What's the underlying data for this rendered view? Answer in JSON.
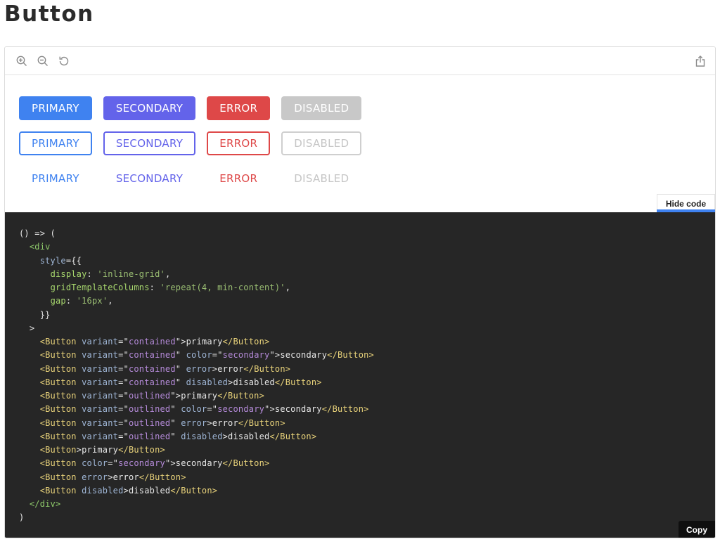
{
  "page": {
    "title": "Button"
  },
  "toolbar": {
    "icons": [
      "zoom-in-icon",
      "zoom-out-icon",
      "reset-zoom-icon",
      "share-icon"
    ]
  },
  "preview": {
    "rows": [
      {
        "variant": "contained",
        "buttons": [
          {
            "label": "PRIMARY",
            "color": "primary",
            "disabled": false
          },
          {
            "label": "SECONDARY",
            "color": "secondary",
            "disabled": false
          },
          {
            "label": "ERROR",
            "color": "error",
            "disabled": false
          },
          {
            "label": "DISABLED",
            "color": "disabled",
            "disabled": true
          }
        ]
      },
      {
        "variant": "outlined",
        "buttons": [
          {
            "label": "PRIMARY",
            "color": "primary",
            "disabled": false
          },
          {
            "label": "SECONDARY",
            "color": "secondary",
            "disabled": false
          },
          {
            "label": "ERROR",
            "color": "error",
            "disabled": false
          },
          {
            "label": "DISABLED",
            "color": "disabled",
            "disabled": true
          }
        ]
      },
      {
        "variant": "text",
        "buttons": [
          {
            "label": "PRIMARY",
            "color": "primary",
            "disabled": false
          },
          {
            "label": "SECONDARY",
            "color": "secondary",
            "disabled": false
          },
          {
            "label": "ERROR",
            "color": "error",
            "disabled": false
          },
          {
            "label": "DISABLED",
            "color": "disabled",
            "disabled": true
          }
        ]
      }
    ]
  },
  "colors": {
    "primary": "#3f82f0",
    "secondary": "#6363ea",
    "error": "#de4848",
    "disabled": "#c8c8c8",
    "code_background": "#262626",
    "tag": "#e8d27a",
    "attribute": "#9fb6d6",
    "string": "#b48ad8",
    "css_property": "#a8d86e",
    "css_string": "#9bbf73",
    "jsx_tag": "#8ec96a"
  },
  "code": {
    "hide_label": "Hide code",
    "copy_label": "Copy",
    "lines": [
      [
        {
          "t": "() => (",
          "c": "p"
        }
      ],
      [
        {
          "t": "  ",
          "c": "p"
        },
        {
          "t": "<div",
          "c": "jt"
        }
      ],
      [
        {
          "t": "    ",
          "c": "p"
        },
        {
          "t": "style",
          "c": "at"
        },
        {
          "t": "={{",
          "c": "p"
        }
      ],
      [
        {
          "t": "      ",
          "c": "p"
        },
        {
          "t": "display",
          "c": "cp"
        },
        {
          "t": ": ",
          "c": "p"
        },
        {
          "t": "'inline-grid'",
          "c": "cs"
        },
        {
          "t": ",",
          "c": "p"
        }
      ],
      [
        {
          "t": "      ",
          "c": "p"
        },
        {
          "t": "gridTemplateColumns",
          "c": "cp"
        },
        {
          "t": ": ",
          "c": "p"
        },
        {
          "t": "'repeat(4, min-content)'",
          "c": "cs"
        },
        {
          "t": ",",
          "c": "p"
        }
      ],
      [
        {
          "t": "      ",
          "c": "p"
        },
        {
          "t": "gap",
          "c": "cp"
        },
        {
          "t": ": ",
          "c": "p"
        },
        {
          "t": "'16px'",
          "c": "cs"
        },
        {
          "t": ",",
          "c": "p"
        }
      ],
      [
        {
          "t": "    }}",
          "c": "p"
        }
      ],
      [
        {
          "t": "  >",
          "c": "p"
        }
      ],
      [
        {
          "t": "    ",
          "c": "p"
        },
        {
          "t": "<Button",
          "c": "tg"
        },
        {
          "t": " variant",
          "c": "at"
        },
        {
          "t": "=\"",
          "c": "p"
        },
        {
          "t": "contained",
          "c": "st"
        },
        {
          "t": "\">primary",
          "c": "p"
        },
        {
          "t": "</Button>",
          "c": "tg"
        }
      ],
      [
        {
          "t": "    ",
          "c": "p"
        },
        {
          "t": "<Button",
          "c": "tg"
        },
        {
          "t": " variant",
          "c": "at"
        },
        {
          "t": "=\"",
          "c": "p"
        },
        {
          "t": "contained",
          "c": "st"
        },
        {
          "t": "\"",
          "c": "p"
        },
        {
          "t": " color",
          "c": "at"
        },
        {
          "t": "=\"",
          "c": "p"
        },
        {
          "t": "secondary",
          "c": "st"
        },
        {
          "t": "\">secondary",
          "c": "p"
        },
        {
          "t": "</Button>",
          "c": "tg"
        }
      ],
      [
        {
          "t": "    ",
          "c": "p"
        },
        {
          "t": "<Button",
          "c": "tg"
        },
        {
          "t": " variant",
          "c": "at"
        },
        {
          "t": "=\"",
          "c": "p"
        },
        {
          "t": "contained",
          "c": "st"
        },
        {
          "t": "\"",
          "c": "p"
        },
        {
          "t": " error",
          "c": "at"
        },
        {
          "t": ">error",
          "c": "p"
        },
        {
          "t": "</Button>",
          "c": "tg"
        }
      ],
      [
        {
          "t": "    ",
          "c": "p"
        },
        {
          "t": "<Button",
          "c": "tg"
        },
        {
          "t": " variant",
          "c": "at"
        },
        {
          "t": "=\"",
          "c": "p"
        },
        {
          "t": "contained",
          "c": "st"
        },
        {
          "t": "\"",
          "c": "p"
        },
        {
          "t": " disabled",
          "c": "at"
        },
        {
          "t": ">disabled",
          "c": "p"
        },
        {
          "t": "</Button>",
          "c": "tg"
        }
      ],
      [
        {
          "t": "    ",
          "c": "p"
        },
        {
          "t": "<Button",
          "c": "tg"
        },
        {
          "t": " variant",
          "c": "at"
        },
        {
          "t": "=\"",
          "c": "p"
        },
        {
          "t": "outlined",
          "c": "st"
        },
        {
          "t": "\">primary",
          "c": "p"
        },
        {
          "t": "</Button>",
          "c": "tg"
        }
      ],
      [
        {
          "t": "    ",
          "c": "p"
        },
        {
          "t": "<Button",
          "c": "tg"
        },
        {
          "t": " variant",
          "c": "at"
        },
        {
          "t": "=\"",
          "c": "p"
        },
        {
          "t": "outlined",
          "c": "st"
        },
        {
          "t": "\"",
          "c": "p"
        },
        {
          "t": " color",
          "c": "at"
        },
        {
          "t": "=\"",
          "c": "p"
        },
        {
          "t": "secondary",
          "c": "st"
        },
        {
          "t": "\">secondary",
          "c": "p"
        },
        {
          "t": "</Button>",
          "c": "tg"
        }
      ],
      [
        {
          "t": "    ",
          "c": "p"
        },
        {
          "t": "<Button",
          "c": "tg"
        },
        {
          "t": " variant",
          "c": "at"
        },
        {
          "t": "=\"",
          "c": "p"
        },
        {
          "t": "outlined",
          "c": "st"
        },
        {
          "t": "\"",
          "c": "p"
        },
        {
          "t": " error",
          "c": "at"
        },
        {
          "t": ">error",
          "c": "p"
        },
        {
          "t": "</Button>",
          "c": "tg"
        }
      ],
      [
        {
          "t": "    ",
          "c": "p"
        },
        {
          "t": "<Button",
          "c": "tg"
        },
        {
          "t": " variant",
          "c": "at"
        },
        {
          "t": "=\"",
          "c": "p"
        },
        {
          "t": "outlined",
          "c": "st"
        },
        {
          "t": "\"",
          "c": "p"
        },
        {
          "t": " disabled",
          "c": "at"
        },
        {
          "t": ">disabled",
          "c": "p"
        },
        {
          "t": "</Button>",
          "c": "tg"
        }
      ],
      [
        {
          "t": "    ",
          "c": "p"
        },
        {
          "t": "<Button",
          "c": "tg"
        },
        {
          "t": ">primary",
          "c": "p"
        },
        {
          "t": "</Button>",
          "c": "tg"
        }
      ],
      [
        {
          "t": "    ",
          "c": "p"
        },
        {
          "t": "<Button",
          "c": "tg"
        },
        {
          "t": " color",
          "c": "at"
        },
        {
          "t": "=\"",
          "c": "p"
        },
        {
          "t": "secondary",
          "c": "st"
        },
        {
          "t": "\">secondary",
          "c": "p"
        },
        {
          "t": "</Button>",
          "c": "tg"
        }
      ],
      [
        {
          "t": "    ",
          "c": "p"
        },
        {
          "t": "<Button",
          "c": "tg"
        },
        {
          "t": " error",
          "c": "at"
        },
        {
          "t": ">error",
          "c": "p"
        },
        {
          "t": "</Button>",
          "c": "tg"
        }
      ],
      [
        {
          "t": "    ",
          "c": "p"
        },
        {
          "t": "<Button",
          "c": "tg"
        },
        {
          "t": " disabled",
          "c": "at"
        },
        {
          "t": ">disabled",
          "c": "p"
        },
        {
          "t": "</Button>",
          "c": "tg"
        }
      ],
      [
        {
          "t": "  ",
          "c": "p"
        },
        {
          "t": "</div>",
          "c": "jt"
        }
      ],
      [
        {
          "t": ")",
          "c": "p"
        }
      ]
    ]
  }
}
